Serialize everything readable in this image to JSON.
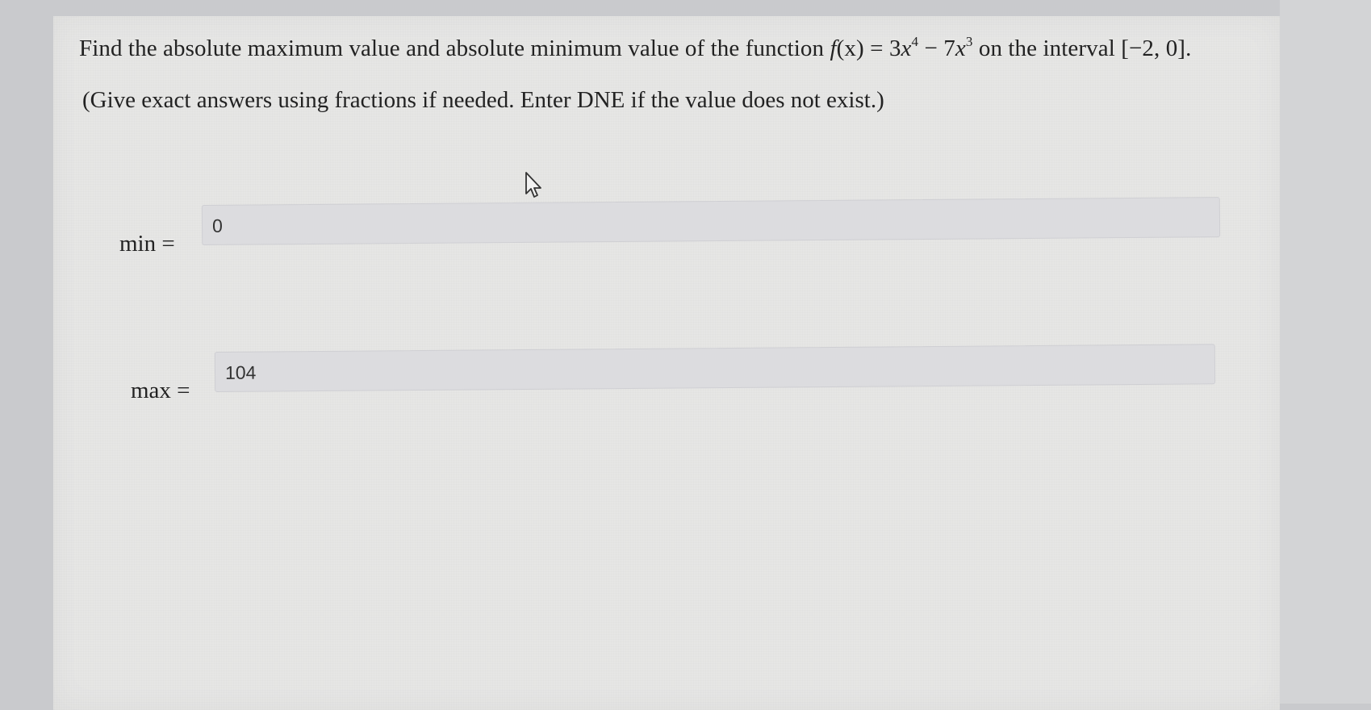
{
  "question": {
    "prefix": "Find the absolute maximum value and absolute minimum value of the function ",
    "func_name": "f",
    "func_arg": "(x) = 3",
    "var1": "x",
    "exp1": "4",
    "minus": " − 7",
    "var2": "x",
    "exp2": "3",
    "suffix": " on the interval [−2, 0]."
  },
  "note": "(Give exact answers using fractions if needed. Enter DNE if the value does not exist.)",
  "min_row": {
    "label": "min =",
    "value": "0"
  },
  "max_row": {
    "label": "max =",
    "value": "104"
  }
}
